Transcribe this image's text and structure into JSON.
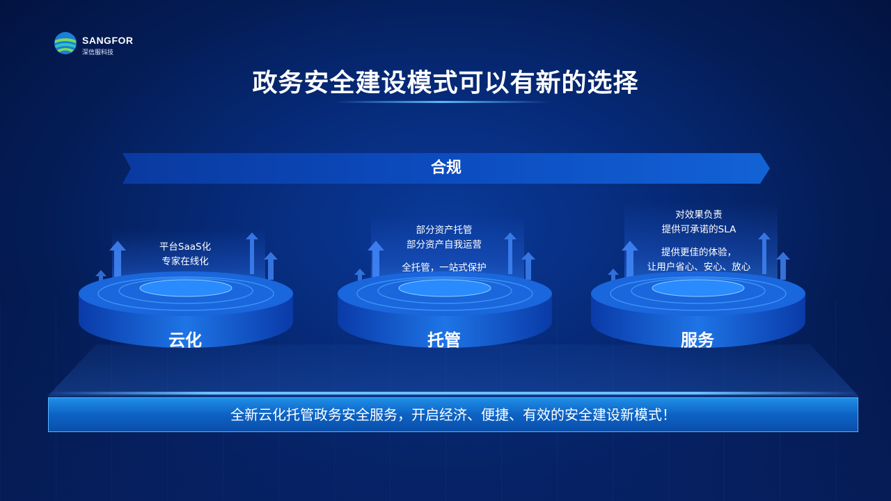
{
  "logo": {
    "name": "SANGFOR",
    "subtitle": "深信服科技"
  },
  "title": "政务安全建设模式可以有新的选择",
  "banner": {
    "label": "合规"
  },
  "stages": [
    {
      "label": "云化",
      "lines": [
        "平台SaaS化",
        "专家在线化"
      ]
    },
    {
      "label": "托管",
      "lines": [
        "部分资产托管",
        "部分资产自我运营",
        "",
        "全托管，一站式保护"
      ]
    },
    {
      "label": "服务",
      "lines": [
        "对效果负责",
        "提供可承诺的SLA",
        "",
        "提供更佳的体验，",
        "让用户省心、安心、放心"
      ]
    }
  ],
  "footer": {
    "text": "全新云化托管政务安全服务，开启经济、便捷、有效的安全建设新模式！"
  },
  "colors": {
    "background": "#062a78",
    "accent": "#1f8ee6",
    "banner": "#0d4fc0"
  }
}
